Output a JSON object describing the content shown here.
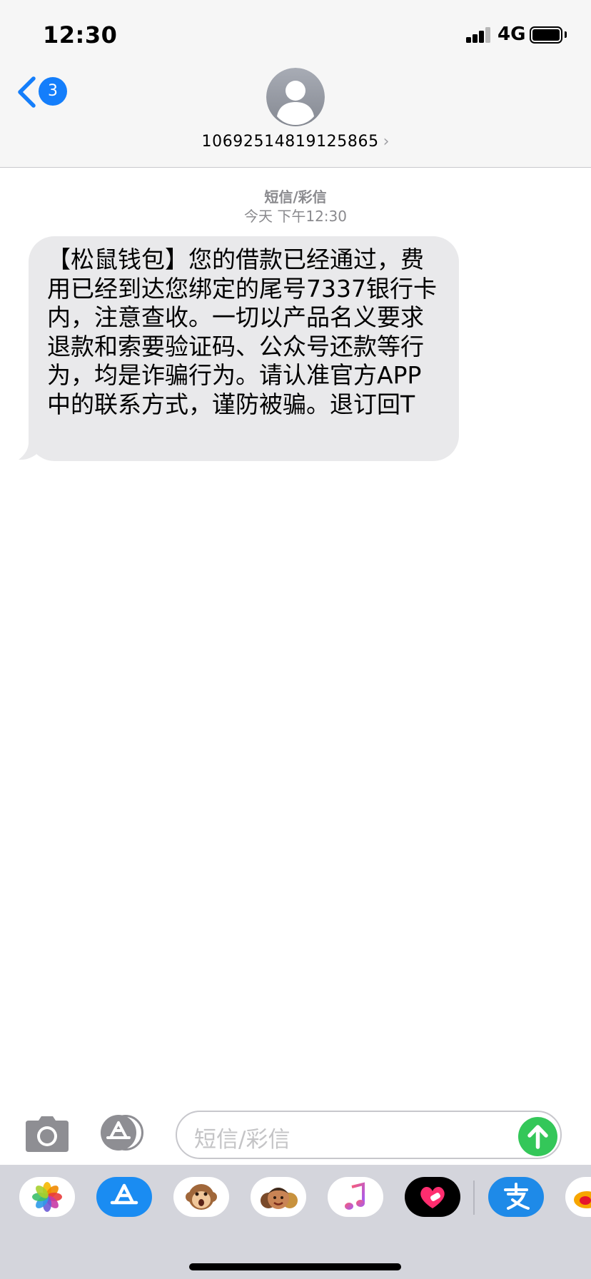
{
  "status_bar": {
    "time": "12:30",
    "network": "4G",
    "battery_level": 1.0
  },
  "header": {
    "unread_count": "3",
    "contact_number": "10692514819125865",
    "back_icon": "chevron-left-icon",
    "avatar_icon": "person-placeholder-icon"
  },
  "conversation": {
    "message_type": "短信/彩信",
    "timestamp": "今天 下午12:30",
    "messages": [
      {
        "direction": "incoming",
        "text": "【松鼠钱包】您的借款已经通过，费用已经到达您绑定的尾号7337银行卡内，注意查收。一切以产品名义要求退款和索要验证码、公众号还款等行为，均是诈骗行为。请认准官方APP中的联系方式，谨防被骗。退订回T"
      }
    ]
  },
  "composer": {
    "placeholder": "短信/彩信",
    "camera_icon": "camera-icon",
    "apps_icon": "app-store-icon",
    "send_icon": "send-arrow-up-icon"
  },
  "app_drawer": {
    "apps": [
      {
        "name": "photos-icon"
      },
      {
        "name": "app-store-icon"
      },
      {
        "name": "animoji-monkey-icon"
      },
      {
        "name": "memoji-icon"
      },
      {
        "name": "music-icon"
      },
      {
        "name": "heart-sticker-icon"
      },
      {
        "name": "alipay-icon"
      },
      {
        "name": "weibo-icon"
      }
    ]
  },
  "colors": {
    "accent": "#147efb",
    "incoming_bubble": "#e9e9eb",
    "send_button": "#34c759",
    "drawer_background": "#d4d5dc"
  }
}
